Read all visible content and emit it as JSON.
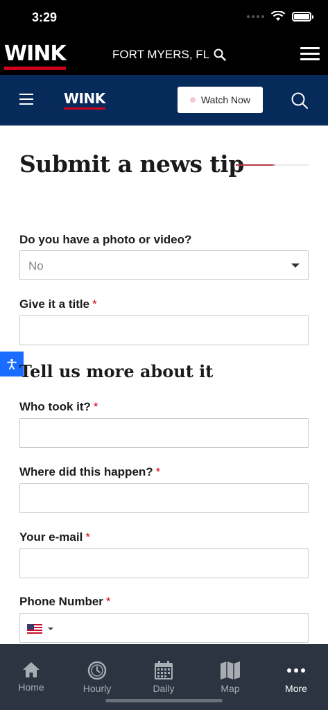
{
  "status": {
    "time": "3:29"
  },
  "header": {
    "logo": "WINK",
    "location": "FORT MYERS, FL"
  },
  "nav": {
    "logo": "WINK",
    "watch_label": "Watch Now"
  },
  "page": {
    "title": "Submit a news tip"
  },
  "form": {
    "photo_label": "Do you have a photo or video?",
    "photo_value": "No",
    "title_label": "Give it a title",
    "section_title": "Tell us more about it",
    "who_label": "Who took it?",
    "where_label": "Where did this happen?",
    "email_label": "Your e-mail",
    "phone_label": "Phone Number",
    "required_mark": "*"
  },
  "tabs": [
    {
      "label": "Home",
      "icon": "home-icon"
    },
    {
      "label": "Hourly",
      "icon": "clock-icon"
    },
    {
      "label": "Daily",
      "icon": "calendar-icon"
    },
    {
      "label": "Map",
      "icon": "map-icon"
    },
    {
      "label": "More",
      "icon": "more-icon"
    }
  ],
  "colors": {
    "brand_red": "#d0021b",
    "nav_blue": "#062a5a",
    "tab_bg": "#2b3440",
    "access_blue": "#1a6cff"
  }
}
